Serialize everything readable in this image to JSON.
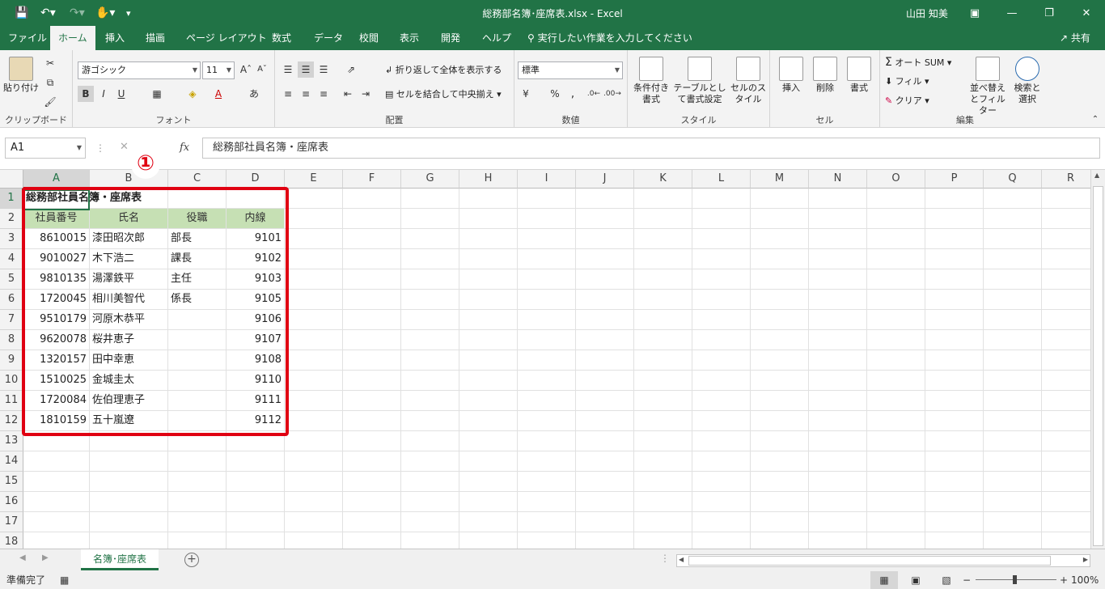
{
  "window": {
    "title": "総務部名簿･座席表.xlsx  -  Excel",
    "user": "山田 知美"
  },
  "menu": {
    "tabs": [
      "ファイル",
      "ホーム",
      "挿入",
      "描画",
      "ページ レイアウト",
      "数式",
      "データ",
      "校閲",
      "表示",
      "開発",
      "ヘルプ"
    ],
    "tellme": "実行したい作業を入力してください",
    "share": "共有"
  },
  "ribbon": {
    "clipboard": {
      "label": "クリップボード",
      "paste": "貼り付け"
    },
    "font": {
      "label": "フォント",
      "name": "游ゴシック",
      "size": "11",
      "bold": "B",
      "italic": "I",
      "underline": "U"
    },
    "alignment": {
      "label": "配置",
      "wrap": "折り返して全体を表示する",
      "merge": "セルを結合して中央揃え"
    },
    "number": {
      "label": "数値",
      "format": "標準",
      "percent": "%"
    },
    "styles": {
      "label": "スタイル",
      "conditional": "条件付き書式",
      "table": "テーブルとして書式設定",
      "cell": "セルのスタイル"
    },
    "cells": {
      "label": "セル",
      "insert": "挿入",
      "delete": "削除",
      "format": "書式"
    },
    "editing": {
      "label": "編集",
      "autosum": "オート SUM",
      "fill": "フィル",
      "clear": "クリア",
      "sort": "並べ替えとフィルター",
      "find": "検索と選択"
    }
  },
  "formula_bar": {
    "name_box": "A1",
    "fx": "fx",
    "content": "総務部社員名簿・座席表"
  },
  "callout": "①",
  "sheet": {
    "columns": [
      "A",
      "B",
      "C",
      "D",
      "E",
      "F",
      "G",
      "H",
      "I",
      "J",
      "K",
      "L",
      "M",
      "N",
      "O",
      "P",
      "Q",
      "R"
    ],
    "rows": [
      "1",
      "2",
      "3",
      "4",
      "5",
      "6",
      "7",
      "8",
      "9",
      "10",
      "11",
      "12",
      "13",
      "14",
      "15",
      "16",
      "17",
      "18"
    ],
    "title": "総務部社員名簿・座席表",
    "headers": [
      "社員番号",
      "氏名",
      "役職",
      "内線"
    ],
    "data": [
      [
        "8610015",
        "漆田昭次郎",
        "部長",
        "9101"
      ],
      [
        "9010027",
        "木下浩二",
        "課長",
        "9102"
      ],
      [
        "9810135",
        "湯澤鉄平",
        "主任",
        "9103"
      ],
      [
        "1720045",
        "相川美智代",
        "係長",
        "9105"
      ],
      [
        "9510179",
        "河原木恭平",
        "",
        "9106"
      ],
      [
        "9620078",
        "桜井恵子",
        "",
        "9107"
      ],
      [
        "1320157",
        "田中幸恵",
        "",
        "9108"
      ],
      [
        "1510025",
        "金城圭太",
        "",
        "9110"
      ],
      [
        "1720084",
        "佐伯理恵子",
        "",
        "9111"
      ],
      [
        "1810159",
        "五十嵐遼",
        "",
        "9112"
      ]
    ]
  },
  "sheet_tab": "名簿･座席表",
  "status": {
    "ready": "準備完了",
    "zoom": "100%",
    "zoom_level_percent": 100
  }
}
